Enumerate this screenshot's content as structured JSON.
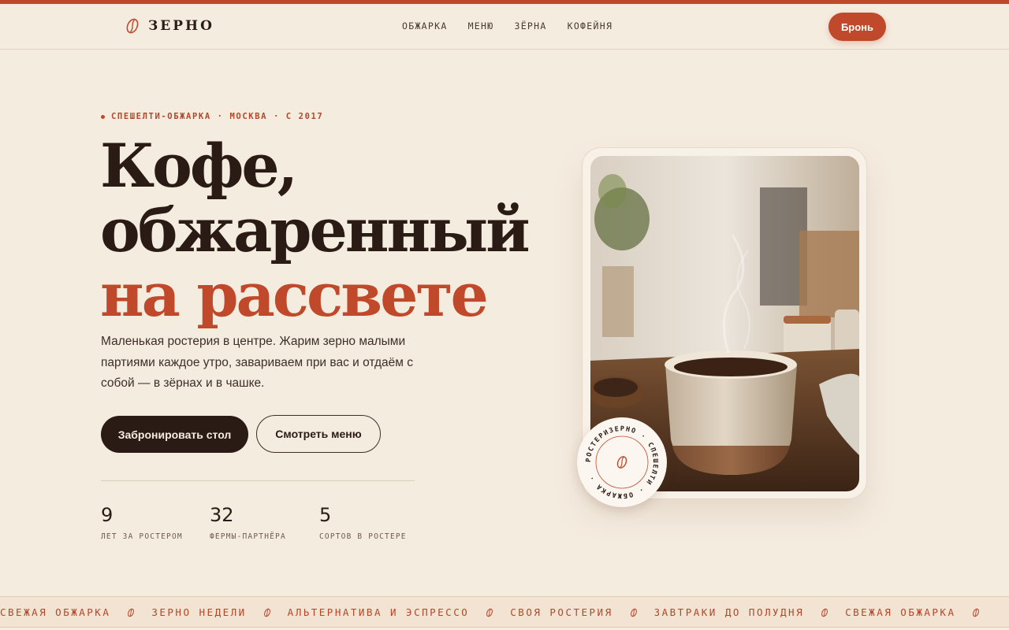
{
  "brand": {
    "name": "ЗЕРНО",
    "icon": "coffee-bean-icon",
    "accent_color": "#c0492b"
  },
  "nav": {
    "items": [
      "ОБЖАРКА",
      "МЕНЮ",
      "ЗЁРНА",
      "КОФЕЙНЯ"
    ]
  },
  "header": {
    "cta_label": "Бронь"
  },
  "hero": {
    "eyebrow": "СПЕШЕЛТИ-ОБЖАРКА · МОСКВА · С 2017",
    "title_line1": "Кофе,",
    "title_line2": "обжаренный",
    "title_line3": "на рассвете",
    "lead": "Маленькая ростерия в центре. Жарим зерно малыми партиями каждое утро, завариваем при вас и отдаём с собой — в зёрнах и в чашке.",
    "primary_button": "Забронировать стол",
    "secondary_button": "Смотреть меню"
  },
  "stats": [
    {
      "value": "9",
      "label": "ЛЕТ ЗА РОСТЕРОМ"
    },
    {
      "value": "32",
      "label": "ФЕРМЫ-ПАРТНЁРА"
    },
    {
      "value": "5",
      "label": "СОРТОВ В РОСТЕРЕ"
    }
  ],
  "badge": {
    "ring_text": "РОСТЕРИЗЕРНО · СПЕШЕЛТИ · ОБЖАРКА ·",
    "icon": "coffee-bean-icon"
  },
  "ticker": {
    "items": [
      "СВЕЖАЯ ОБЖАРКА",
      "ЗЕРНО НЕДЕЛИ",
      "АЛЬТЕРНАТИВА И ЭСПРЕССО",
      "СВОЯ РОСТЕРИЯ",
      "ЗАВТРАКИ ДО ПОЛУДНЯ",
      "СВЕЖАЯ ОБЖАРКА"
    ],
    "separator_icon": "coffee-bean-icon"
  }
}
